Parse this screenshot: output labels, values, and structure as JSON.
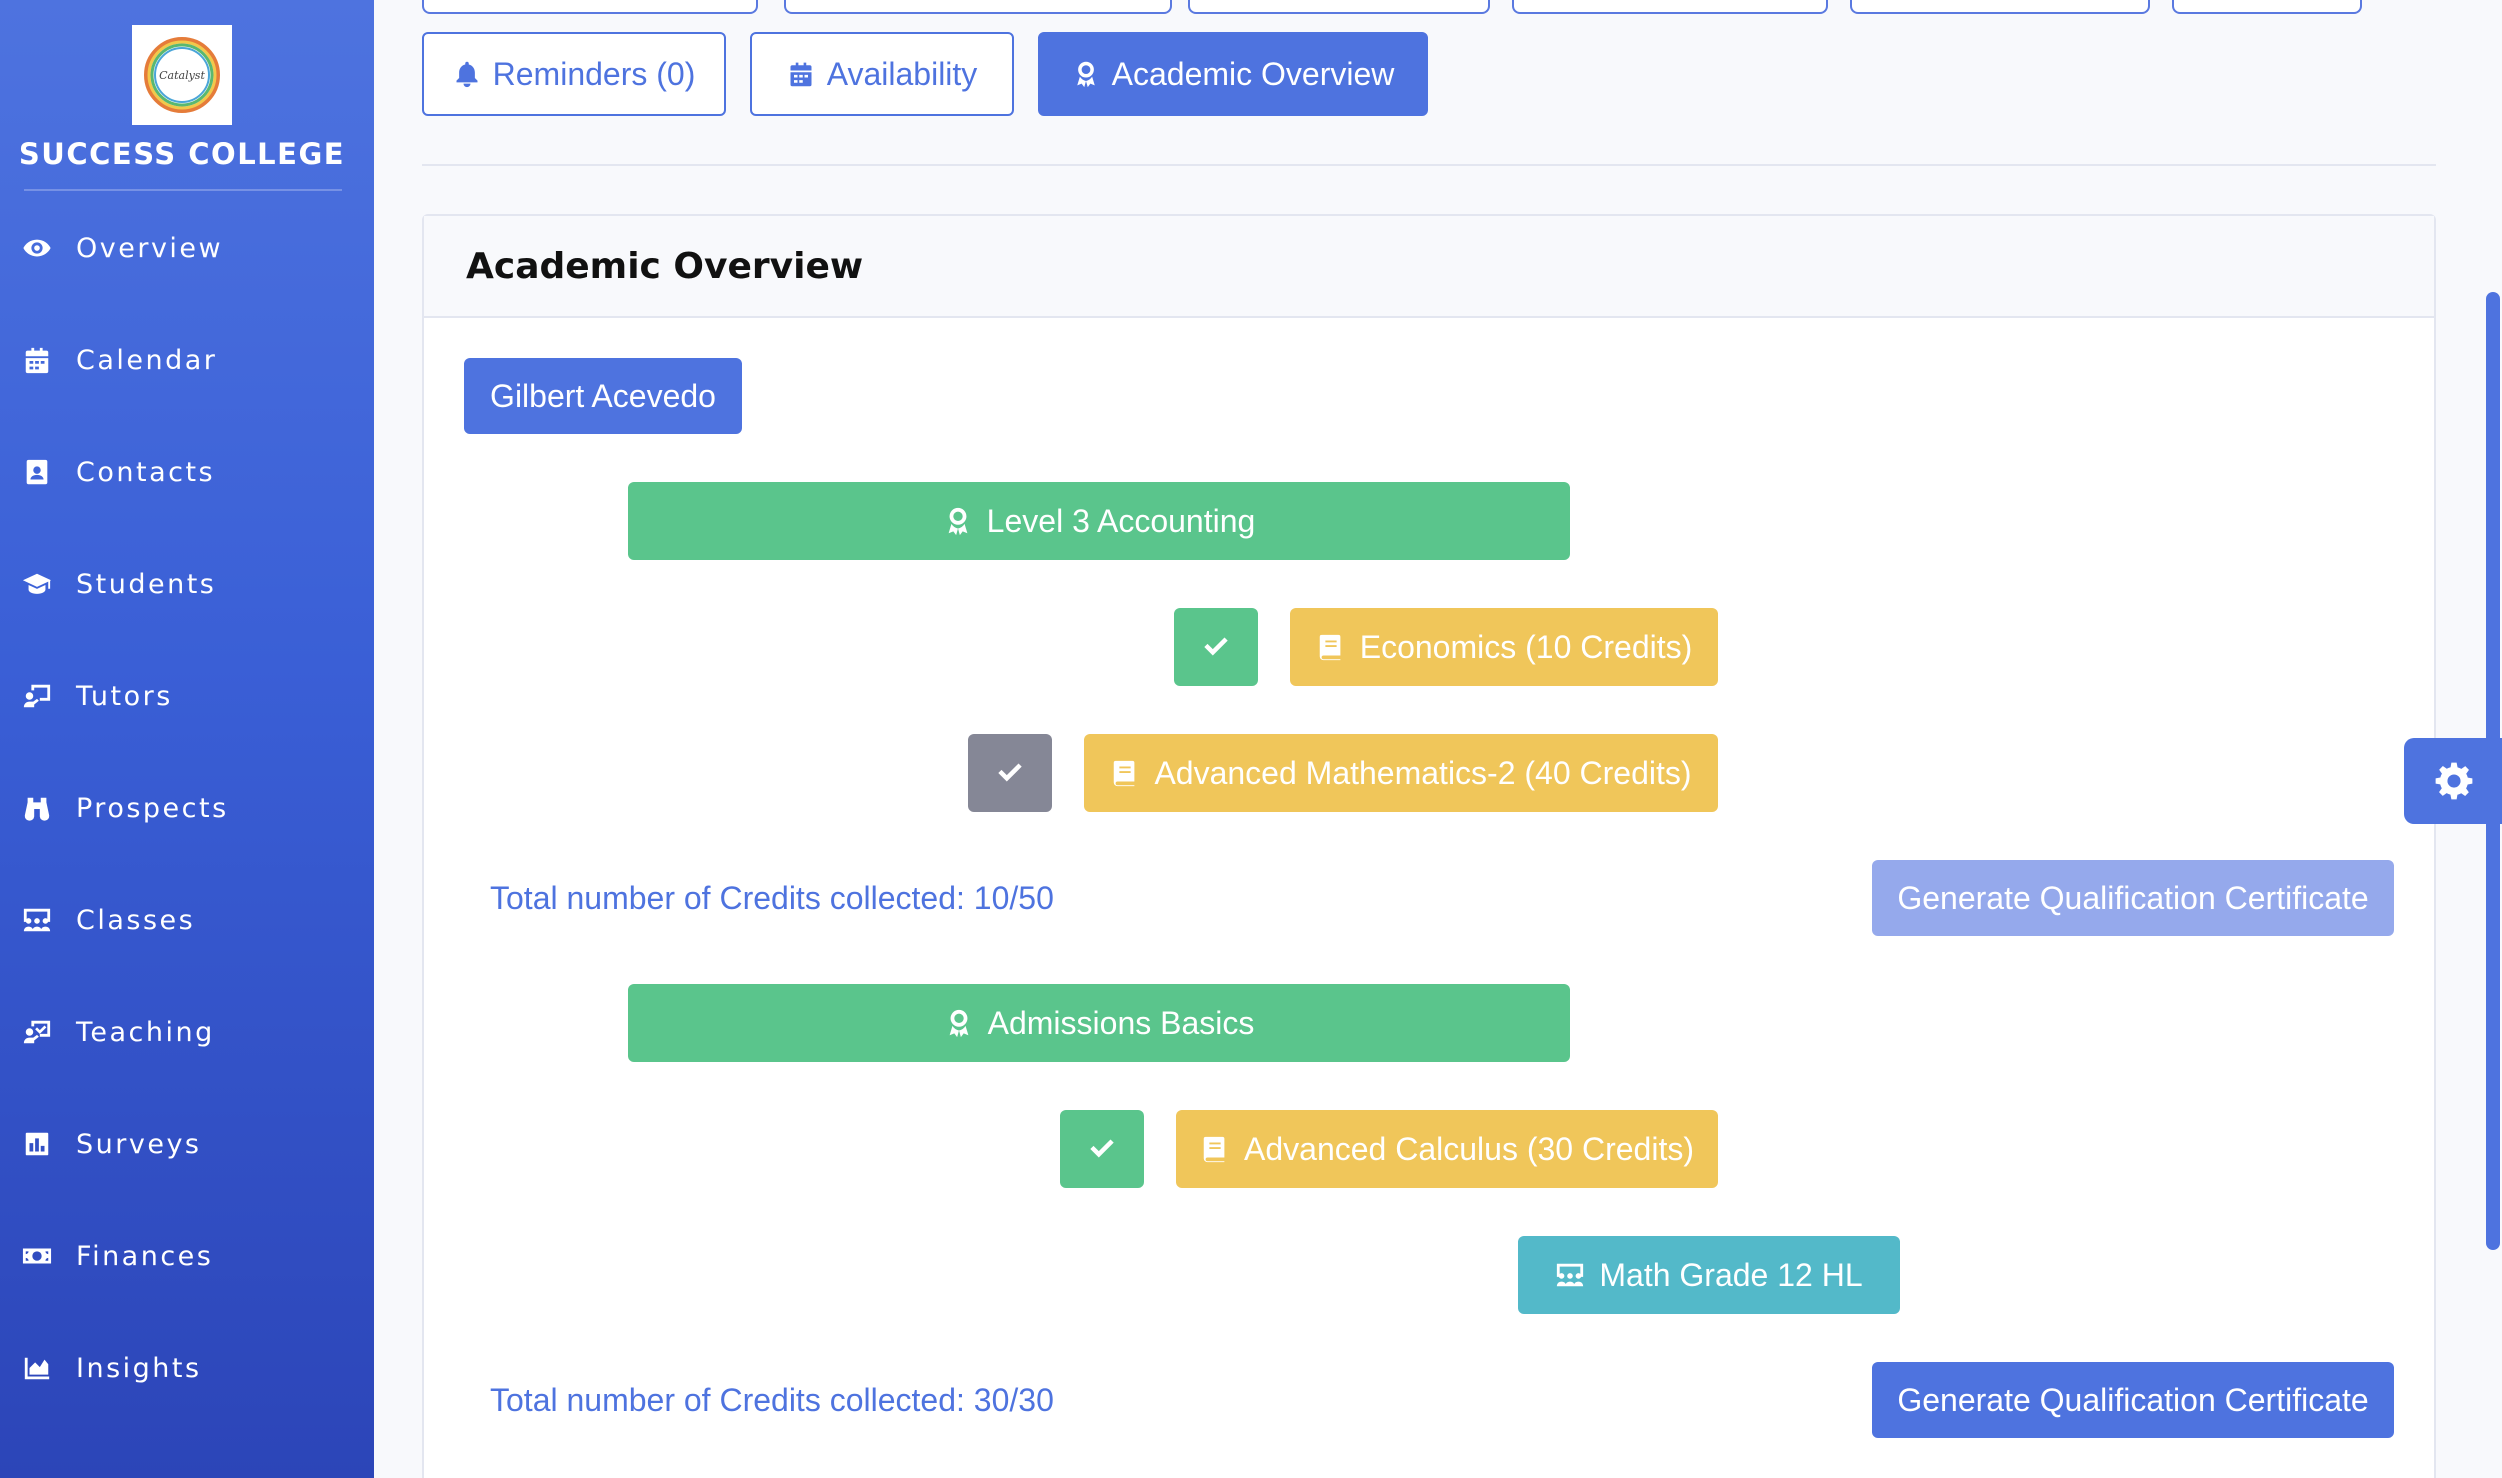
{
  "brand": {
    "name": "SUCCESS COLLEGE",
    "logo_text": "Catalyst"
  },
  "sidebar": {
    "items": [
      {
        "label": "Overview",
        "icon": "eye-icon"
      },
      {
        "label": "Calendar",
        "icon": "calendar-icon"
      },
      {
        "label": "Contacts",
        "icon": "address-book-icon"
      },
      {
        "label": "Students",
        "icon": "graduation-cap-icon"
      },
      {
        "label": "Tutors",
        "icon": "chalkboard-teacher-icon"
      },
      {
        "label": "Prospects",
        "icon": "binoculars-icon"
      },
      {
        "label": "Classes",
        "icon": "users-class-icon"
      },
      {
        "label": "Teaching",
        "icon": "chalkboard-check-icon"
      },
      {
        "label": "Surveys",
        "icon": "poll-icon"
      },
      {
        "label": "Finances",
        "icon": "money-bill-icon"
      },
      {
        "label": "Insights",
        "icon": "chart-area-icon"
      }
    ]
  },
  "tabs": {
    "reminders": "Reminders (0)",
    "availability": "Availability",
    "academic_overview": "Academic Overview"
  },
  "card": {
    "title": "Academic Overview",
    "student": "Gilbert Acevedo",
    "qualifications": [
      {
        "name": "Level 3 Accounting",
        "courses": [
          {
            "name": "Economics (10 Credits)",
            "completed": true
          },
          {
            "name": "Advanced Mathematics-2 (40 Credits)",
            "completed": false
          }
        ],
        "credits_text": "Total number of Credits collected: 10/50",
        "button": "Generate Qualification Certificate",
        "button_enabled": false
      },
      {
        "name": "Admissions Basics",
        "courses": [
          {
            "name": "Advanced Calculus (30 Credits)",
            "completed": true
          }
        ],
        "classes": [
          {
            "name": "Math Grade 12 HL"
          }
        ],
        "credits_text": "Total number of Credits collected: 30/30",
        "button": "Generate Qualification Certificate",
        "button_enabled": true
      }
    ]
  },
  "colors": {
    "primary": "#4e73df",
    "success": "#5ac58c",
    "warning": "#f0c65a",
    "info": "#53b9c9",
    "secondary": "#858796",
    "disabled": "#95a9ec"
  }
}
